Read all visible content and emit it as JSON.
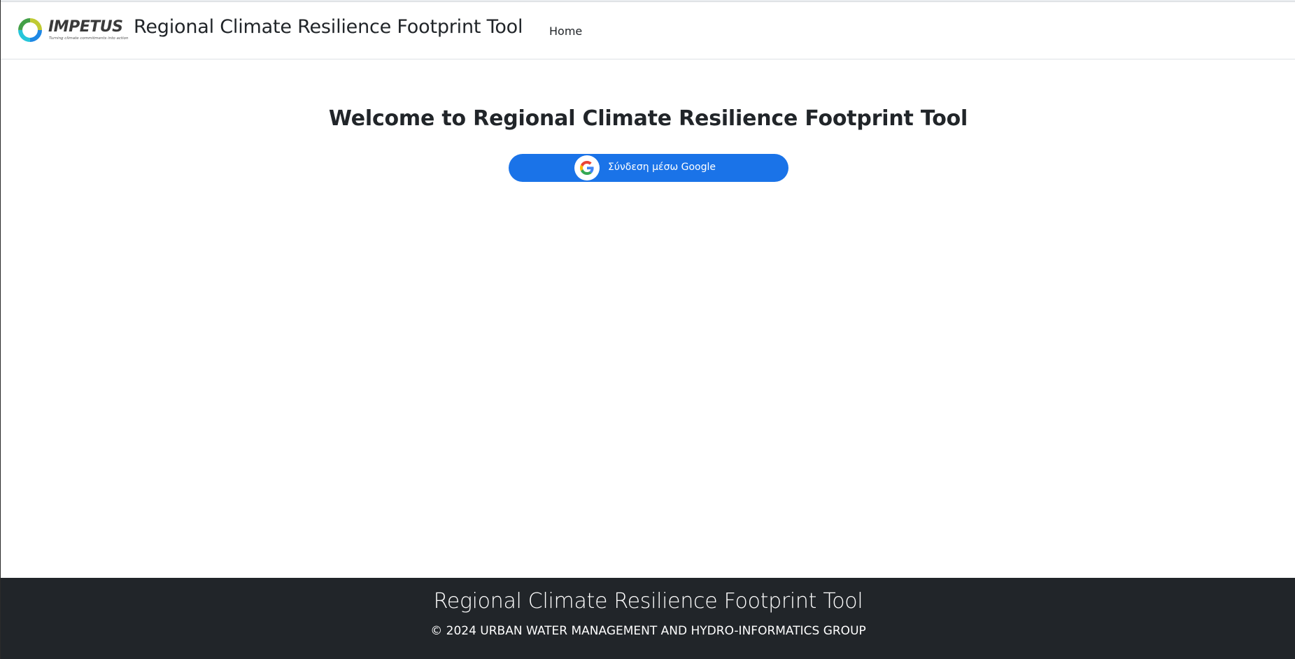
{
  "header": {
    "logo": {
      "name": "IMPETUS",
      "tagline": "Turning climate commitments into action",
      "colors": [
        "#1e88e5",
        "#26c6da",
        "#43a047",
        "#c0ca33"
      ]
    },
    "brand_title": "Regional Climate Resilience Footprint Tool",
    "nav": [
      {
        "label": "Home"
      }
    ]
  },
  "main": {
    "welcome_heading": "Welcome to Regional Climate Resilience Footprint Tool",
    "google_signin": {
      "label": "Σύνδεση μέσω Google",
      "icon": "google-g-icon",
      "color": "#1a73e8"
    }
  },
  "footer": {
    "title": "Regional Climate Resilience Footprint Tool",
    "copyright": "© 2024 URBAN WATER MANAGEMENT AND HYDRO-INFORMATICS GROUP",
    "background": "#212529"
  }
}
